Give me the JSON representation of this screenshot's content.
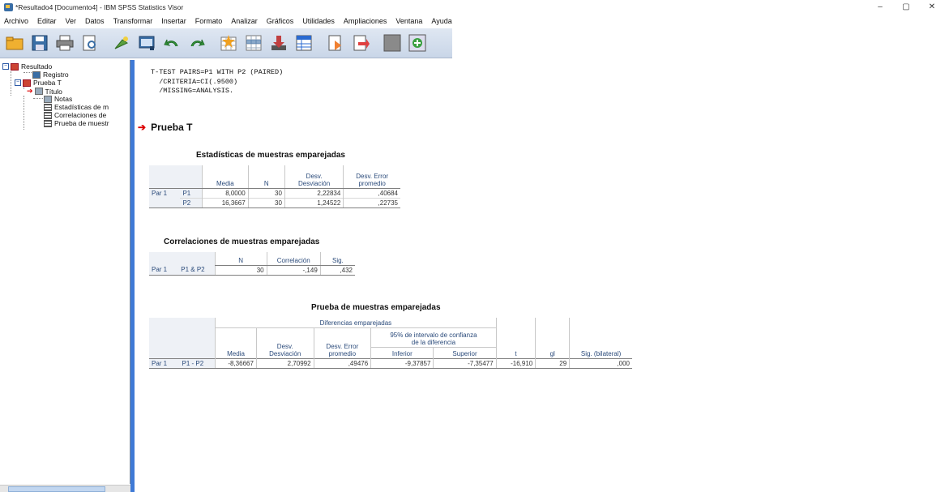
{
  "window": {
    "title": "*Resultado4 [Documento4] - IBM SPSS Statistics Visor",
    "controls": {
      "minimize": "–",
      "maximize": "▢",
      "close": "✕"
    }
  },
  "menu": [
    "Archivo",
    "Editar",
    "Ver",
    "Datos",
    "Transformar",
    "Insertar",
    "Formato",
    "Analizar",
    "Gráficos",
    "Utilidades",
    "Ampliaciones",
    "Ventana",
    "Ayuda"
  ],
  "toolbar": {
    "buttons": [
      {
        "name": "open-icon",
        "color": "#e8a020"
      },
      {
        "name": "save-icon",
        "color": "#3a6ea5"
      },
      {
        "name": "print-icon",
        "color": "#555"
      },
      {
        "name": "print-preview-icon",
        "color": "#3a6ea5"
      },
      {
        "name": "export-icon",
        "color": "#4a9a40"
      },
      {
        "name": "recall-dialog-icon",
        "color": "#3a6ea5"
      },
      {
        "name": "undo-icon",
        "color": "#2f8a3a"
      },
      {
        "name": "redo-icon",
        "color": "#2f8a3a"
      },
      {
        "name": "goto-data-icon",
        "color": "#d04a2a"
      },
      {
        "name": "goto-case-icon",
        "color": "#3a6ea5"
      },
      {
        "name": "goto-variable-icon",
        "color": "#c04040"
      },
      {
        "name": "variables-icon",
        "color": "#2a6ad0"
      },
      {
        "name": "designated-window-icon",
        "color": "#c87840"
      },
      {
        "name": "select-last-output-icon",
        "color": "#e05050"
      },
      {
        "name": "create-title-icon",
        "color": "#8a8a8a"
      },
      {
        "name": "insert-heading-icon",
        "color": "#3aa040"
      }
    ]
  },
  "nav": {
    "root": "Resultado",
    "log": "Registro",
    "group": "Prueba T",
    "children": [
      "Título",
      "Notas",
      "Estadísticas de m",
      "Correlaciones de",
      "Prueba de muestr"
    ]
  },
  "syntax": "T-TEST PAIRS=P1 WITH P2 (PAIRED)\n  /CRITERIA=CI(.9500)\n  /MISSING=ANALYSIS.",
  "section_title": "Prueba T",
  "table1": {
    "title": "Estadísticas de muestras emparejadas",
    "headers": [
      "Media",
      "N",
      "Desv.\nDesviación",
      "Desv. Error\npromedio"
    ],
    "pair": "Par 1",
    "rows": [
      {
        "var": "P1",
        "media": "8,0000",
        "n": "30",
        "desv": "2,22834",
        "err": ",40684"
      },
      {
        "var": "P2",
        "media": "16,3667",
        "n": "30",
        "desv": "1,24522",
        "err": ",22735"
      }
    ]
  },
  "table2": {
    "title": "Correlaciones de muestras emparejadas",
    "headers": [
      "N",
      "Correlación",
      "Sig."
    ],
    "pair": "Par 1",
    "var": "P1 & P2",
    "n": "30",
    "corr": "-,149",
    "sig": ",432"
  },
  "table3": {
    "title": "Prueba de muestras emparejadas",
    "group_header": "Diferencias emparejadas",
    "ci_header": "95% de intervalo de confianza\nde la diferencia",
    "headers": {
      "media": "Media",
      "desv": "Desv.\nDesviación",
      "err": "Desv. Error\npromedio",
      "inf": "Inferior",
      "sup": "Superior",
      "t": "t",
      "gl": "gl",
      "sig": "Sig. (bilateral)"
    },
    "pair": "Par 1",
    "var": "P1 - P2",
    "values": {
      "media": "-8,36667",
      "desv": "2,70992",
      "err": ",49476",
      "inf": "-9,37857",
      "sup": "-7,35477",
      "t": "-16,910",
      "gl": "29",
      "sig": ",000"
    }
  }
}
